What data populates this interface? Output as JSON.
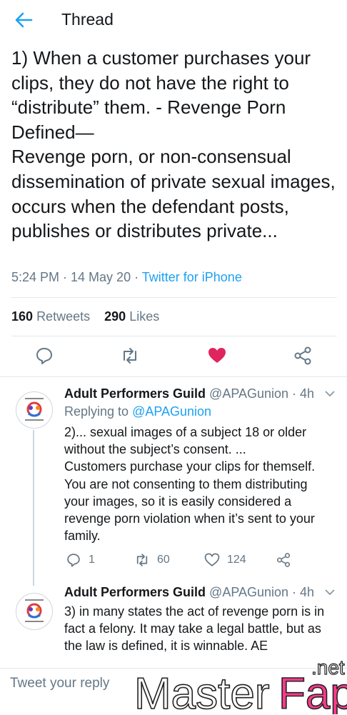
{
  "header": {
    "title": "Thread",
    "back_icon": "arrow-left-icon"
  },
  "tweet": {
    "text": "1) When a customer purchases your clips, they do not have the right to “distribute” them. - Revenge Porn Defined—\nRevenge porn, or non-consensual dissemination of private sexual images, occurs when the defendant posts, publishes or distributes private...",
    "time": "5:24 PM · 14 May 20 · ",
    "source": "Twitter for iPhone",
    "retweets_count": "160",
    "retweets_label": "Retweets",
    "likes_count": "290",
    "likes_label": "Likes",
    "like_color": "#e0245e"
  },
  "replies": [
    {
      "name": "Adult Performers Guild",
      "handle": "@APAGunion · 4h",
      "replying_prefix": "Replying to ",
      "replying_to": "@APAGunion",
      "text": "2)... sexual images of a subject 18 or older without the subject’s consent. ...\nCustomers purchase your clips for themself. You are not consenting to them distributing your images, so it is easily considered a revenge porn violation when it’s sent to your family.",
      "reply_count": "1",
      "retweet_count": "60",
      "like_count": "124"
    },
    {
      "name": "Adult Performers Guild",
      "handle": "@APAGunion · 4h",
      "text": "3) in many states the act of revenge porn is in fact a felony. It may take a legal battle, but as the law is defined, it is winnable. AE"
    }
  ],
  "composer": {
    "placeholder": "Tweet your reply"
  },
  "watermark": {
    "text_main": "Master",
    "text_accent": "Fap",
    "text_tld": ".net",
    "accent_color": "#ff3a8c"
  },
  "accent": "#1da1f2"
}
